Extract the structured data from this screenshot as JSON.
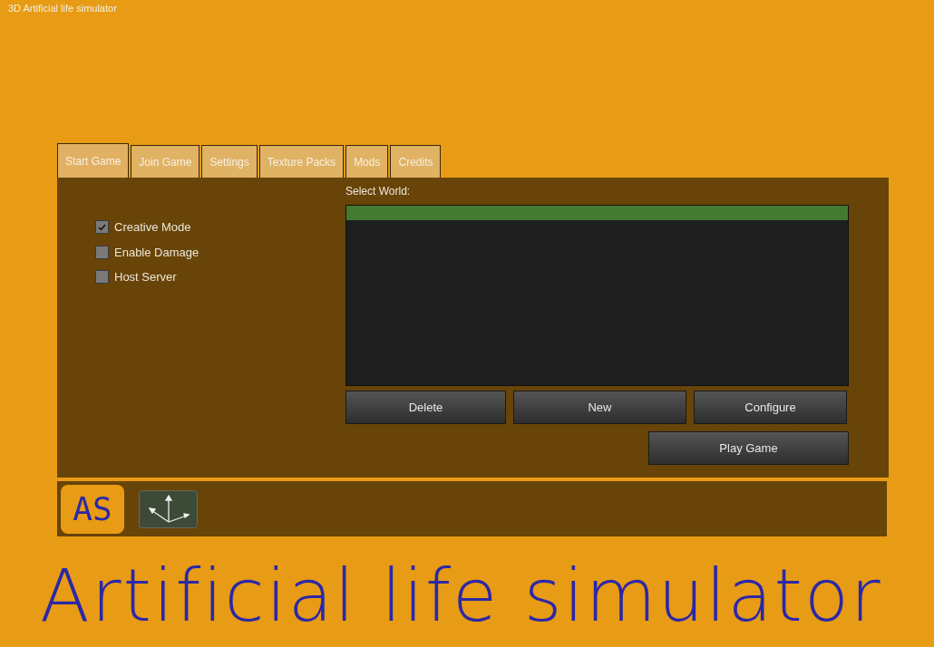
{
  "window": {
    "title": "3D Artificial life simulator"
  },
  "tabs": [
    {
      "label": "Start Game",
      "selected": true
    },
    {
      "label": "Join Game",
      "selected": false
    },
    {
      "label": "Settings",
      "selected": false
    },
    {
      "label": "Texture Packs",
      "selected": false
    },
    {
      "label": "Mods",
      "selected": false
    },
    {
      "label": "Credits",
      "selected": false
    }
  ],
  "options": [
    {
      "label": "Creative Mode",
      "checked": true
    },
    {
      "label": "Enable Damage",
      "checked": false
    },
    {
      "label": "Host Server",
      "checked": false
    }
  ],
  "world_list": {
    "label": "Select World:",
    "rows": [
      {
        "selected": true
      }
    ]
  },
  "world_buttons": [
    "Delete",
    "New",
    "Configure"
  ],
  "play_button": "Play Game",
  "bottom_bar": {
    "logo": "AS"
  },
  "banner": "Artificial life simulator"
}
